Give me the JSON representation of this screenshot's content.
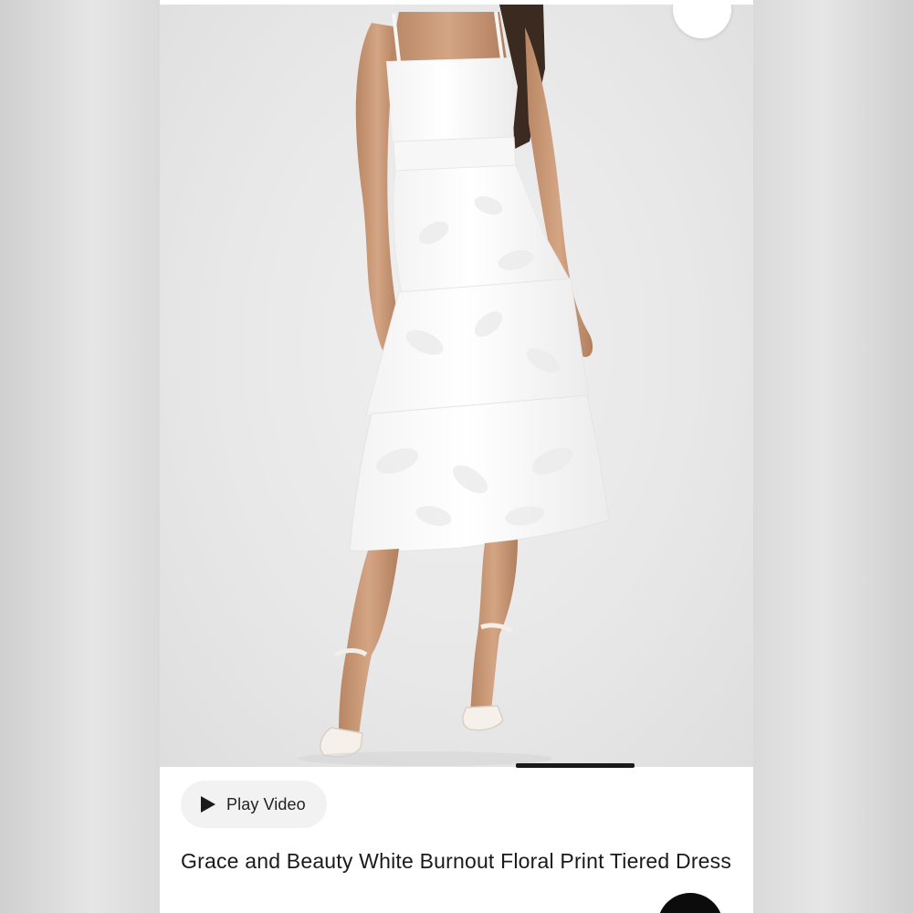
{
  "product": {
    "image_alt": "White tiered floral print midi dress with spaghetti straps",
    "title": "Grace and Beauty White Burnout Floral Print Tiered Dress",
    "play_video_label": "Play Video"
  },
  "icons": {
    "collapse": "arrow-collapse-icon",
    "play": "play-icon",
    "fab": "floating-action-button"
  },
  "colors": {
    "background": "#dadada",
    "card": "#ffffff",
    "pill": "#f2f2f2",
    "text": "#1a1a1a",
    "dress": "#ffffff",
    "skin": "#c99a78",
    "hair": "#3b2a20"
  }
}
